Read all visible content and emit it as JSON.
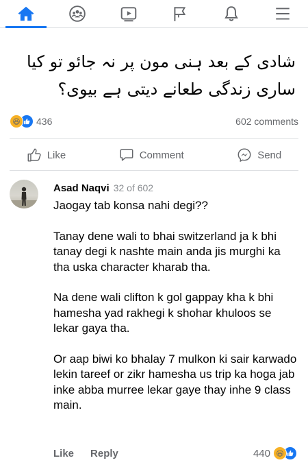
{
  "nav": {
    "tabs": [
      {
        "name": "home-icon",
        "active": true
      },
      {
        "name": "groups-icon",
        "active": false
      },
      {
        "name": "watch-icon",
        "active": false
      },
      {
        "name": "pages-flag-icon",
        "active": false
      },
      {
        "name": "notifications-bell-icon",
        "active": false
      },
      {
        "name": "menu-icon",
        "active": false
      }
    ],
    "accent": "#1877f2"
  },
  "post": {
    "text_line1": "شادی کے بعد ہنی مون پر نہ جائو تو کیا",
    "text_line2": "ساری زندگی طعانے دیتی ہے بیوی؟",
    "reaction_count": "436",
    "comments_count": "602 comments"
  },
  "actions": {
    "like": "Like",
    "comment": "Comment",
    "send": "Send"
  },
  "comment": {
    "author": "Asad Naqvi",
    "position": "32 of 602",
    "paragraphs": [
      "Jaogay tab konsa nahi degi??",
      "Tanay dene wali to bhai switzerland ja k bhi tanay degi k nashte main anda jis murghi ka tha uska character kharab tha.",
      "Na dene wali clifton k gol gappay kha k bhi hamesha yad rakhegi k shohar khuloos se lekar gaya tha.",
      "Or aap biwi ko bhalay 7 mulkon ki sair karwado lekin tareef or zikr hamesha us trip ka hoga jab inke abba murree lekar gaye thay inhe 9 class main."
    ],
    "like_label": "Like",
    "reply_label": "Reply",
    "reaction_count": "440"
  }
}
